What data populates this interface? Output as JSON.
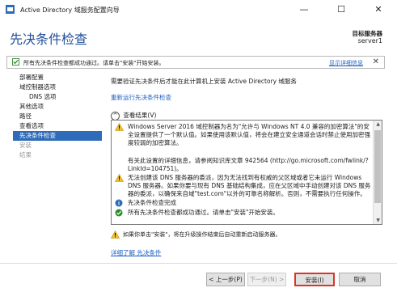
{
  "window": {
    "title": "Active Directory 域服务配置向导",
    "minimize": "—",
    "maximize": "☐",
    "close": "✕"
  },
  "header": {
    "page_title": "先决条件检查",
    "target_label": "目标服务器",
    "target_name": "server1"
  },
  "info_bar": {
    "text": "所有先决条件检查都成功通过。请单击\"安装\"开始安装。",
    "link": "显示详细信息",
    "close": "✕"
  },
  "nav": {
    "items": [
      {
        "label": "部署配置",
        "state": "normal"
      },
      {
        "label": "域控制器选项",
        "state": "normal"
      },
      {
        "label": "DNS 选项",
        "state": "sub"
      },
      {
        "label": "其他选项",
        "state": "normal"
      },
      {
        "label": "路径",
        "state": "normal"
      },
      {
        "label": "查看选项",
        "state": "normal"
      },
      {
        "label": "先决条件检查",
        "state": "active"
      },
      {
        "label": "安装",
        "state": "disabled"
      },
      {
        "label": "结果",
        "state": "disabled"
      }
    ]
  },
  "main": {
    "lead": "需要验证先决条件后才能在此计算机上安装 Active Directory 域服务",
    "rerun_link": "重新运行先决条件检查",
    "results_toggle_icon": "^",
    "results_toggle": "查看结果(V)",
    "results": [
      {
        "icon": "warning-icon",
        "text": "Windows Server 2016 域控制器为名为\"允许与 Windows NT 4.0 兼容的加密算法\"的安全设置提供了一个默认值。如果使用该默认值，将会在建立安全通道会话时禁止使用加密强度较弱的加密算法。"
      },
      {
        "icon": "none",
        "text": "有关此设置的详细信息，请参阅知识库文章 942564 (http://go.microsoft.com/fwlink/?LinkId=104751)。"
      },
      {
        "icon": "warning-icon",
        "text": "无法创建该 DNS 服务器的委派，因为无法找到有权威的父区域或者它未运行 Windows DNS 服务器。如果你要与现有 DNS 基础结构集成，应在父区域中手动创建对该 DNS 服务器的委派，以确保来自域\"test.com\"以外的可靠名称解析。否则，不需要执行任何操作。"
      },
      {
        "icon": "info-icon",
        "text": "先决条件检查完成"
      },
      {
        "icon": "success-icon",
        "text": "所有先决条件检查都成功通过。请单击\"安装\"开始安装。"
      }
    ],
    "bottom_warning": "如果你单击\"安装\"，将在升级操作结束后自动重新启动服务器。",
    "more_link": "详细了解 先决条件"
  },
  "footer": {
    "prev": "< 上一步(P)",
    "next": "下一步(N) >",
    "install": "安装(I)",
    "cancel": "取消"
  },
  "colors": {
    "accent": "#1f4f9a",
    "nav_active": "#2e6bb8",
    "link": "#1f5fbf",
    "focus_outline": "#d9352b"
  }
}
